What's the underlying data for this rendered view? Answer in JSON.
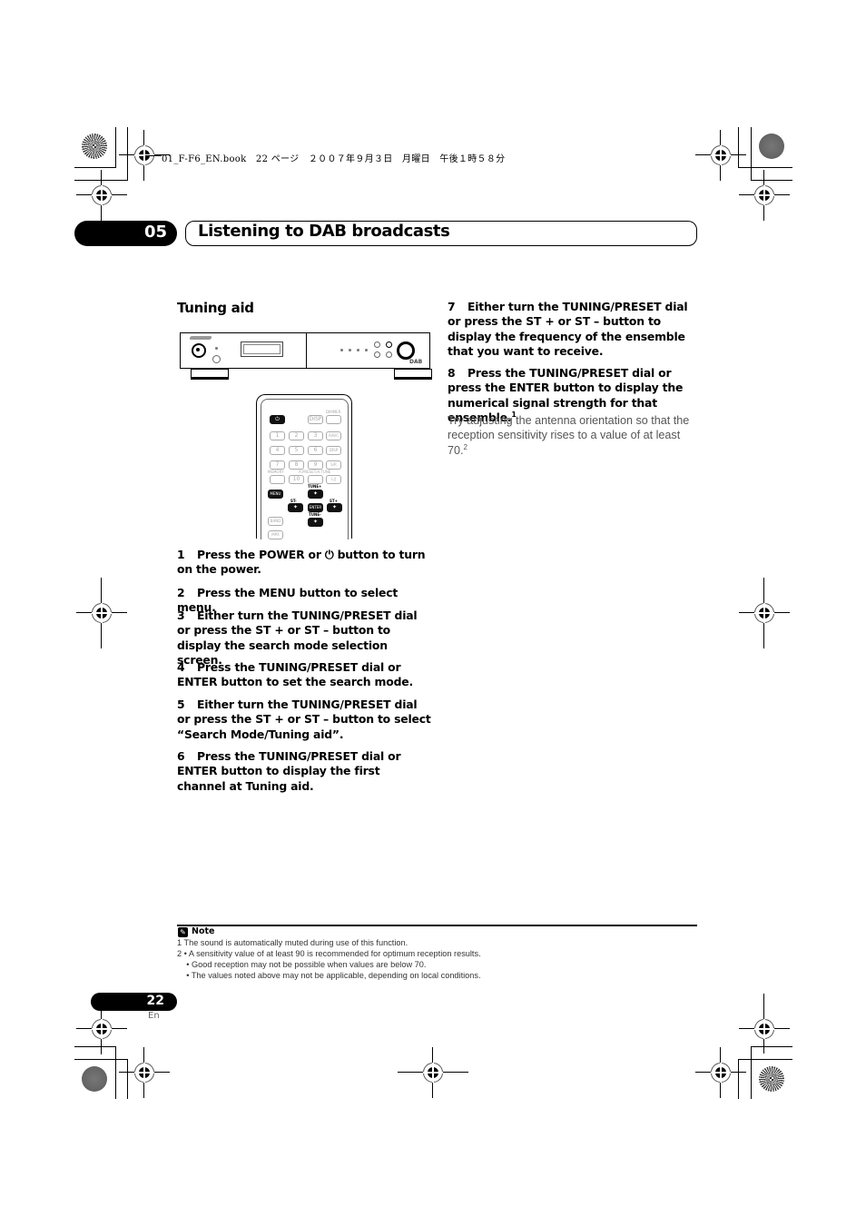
{
  "print_header": {
    "file_line": "01_F-F6_EN.book   22 ページ   ２００７年９月３日   月曜日   午後１時５８分"
  },
  "chapter": {
    "number": "05",
    "title": "Listening to DAB broadcasts"
  },
  "section": {
    "title": "Tuning aid"
  },
  "illustrations": {
    "front_panel": {
      "badge": "DAB"
    },
    "remote": {
      "buttons": [
        "⏻",
        "DISP",
        "DIMMER",
        "1",
        "2",
        "3",
        "A/B/C",
        "4",
        "5",
        "6",
        "DISP",
        "7",
        "8",
        "9",
        "S/R",
        "MEMORY",
        "10",
        "A.PRESET/A.TUNE",
        "L/J",
        "MENU",
        "TUNE+",
        "ST-",
        "ENTER",
        "ST+",
        "TUNE-",
        "BAND",
        "MPX"
      ],
      "labels": {
        "power": "⏻",
        "disp": "DISP",
        "dimmer": "DIMMER",
        "num1": "1",
        "num2": "2",
        "num3": "3",
        "abc": "A/B/C",
        "num4": "4",
        "num5": "5",
        "num6": "6",
        "disp2": "DISP",
        "num7": "7",
        "num8": "8",
        "num9": "9",
        "sr": "S/R",
        "memory": "MEMORY",
        "num10": "10",
        "apreset": "A.PRESET/A.TUNE",
        "lj": "L/J",
        "menu": "MENU",
        "tune_plus": "TUNE+",
        "st_minus": "ST-",
        "enter": "ENTER",
        "st_plus": "ST+",
        "tune_minus": "TUNE-",
        "band": "BAND",
        "mpx": "MPX",
        "arrow": "✦"
      }
    }
  },
  "steps_left": [
    {
      "num": "1",
      "text": "Press the POWER or ⏻ button to turn on the power."
    },
    {
      "num": "2",
      "text": "Press the MENU button to select menu."
    },
    {
      "num": "3",
      "text": "Either turn the TUNING/PRESET dial or press the ST + or ST – button to display the search mode selection screen."
    },
    {
      "num": "4",
      "text": "Press the TUNING/PRESET dial or ENTER button to set the search mode."
    },
    {
      "num": "5",
      "text": "Either turn the TUNING/PRESET dial or press the ST + or ST – button to select “Search Mode/Tuning aid”."
    },
    {
      "num": "6",
      "text": "Press the TUNING/PRESET dial or ENTER button to display the first channel at Tuning aid."
    }
  ],
  "steps_right": [
    {
      "num": "7",
      "text": "Either turn the TUNING/PRESET dial or press the ST + or ST – button to display the frequency of the ensemble that you want to receive."
    },
    {
      "num": "8",
      "text": "Press the TUNING/PRESET dial or press the ENTER button to display the numerical signal strength for that ensemble.",
      "sup": "1"
    }
  ],
  "step8_body": {
    "text": "Try adjusting the antenna orientation so that the reception sensitivity rises to a value of at least 70.",
    "sup": "2"
  },
  "note": {
    "title": "Note",
    "lines": [
      "1  The sound is automatically muted during use of this function.",
      "2  • A sensitivity value of at least 90 is recommended for optimum reception results.",
      "    • Good reception may not be possible when values are below 70.",
      "    • The values noted above may not be applicable, depending on local conditions."
    ]
  },
  "page": {
    "number": "22",
    "lang": "En"
  }
}
